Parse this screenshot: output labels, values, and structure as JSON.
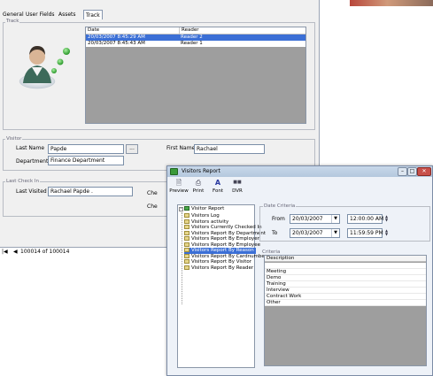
{
  "main": {
    "tabs": [
      "General",
      "User Fields",
      "Assets",
      "Track"
    ],
    "track": {
      "legend": "Track",
      "columns": [
        "Date",
        "Reader"
      ],
      "rows": [
        {
          "date": "20/03/2007 8:45:29 AM",
          "reader": "Reader 2"
        },
        {
          "date": "20/03/2007 8:45:43 AM",
          "reader": "Reader 1"
        }
      ]
    },
    "visitor": {
      "legend": "Visitor",
      "last_name_label": "Last Name",
      "last_name_value": "Papde",
      "dots": "...",
      "first_name_label": "First Name",
      "first_name_value": "Rachael",
      "department_label": "Department",
      "department_value": "Finance Department"
    },
    "check_in": {
      "legend": "Last Check In",
      "last_visited_label": "Last Visited",
      "last_visited_value": "Rachael Papde .",
      "che_label_1": "Che",
      "che_label_2": "Che"
    },
    "nav": {
      "record_text": "100014 of 100014"
    }
  },
  "report_window": {
    "title": "Visitors Report",
    "toolbar": [
      "Preview",
      "Print",
      "Font",
      "DVR"
    ],
    "tree": {
      "root": "Visitor Report",
      "items": [
        "Visitors Log",
        "Visitors activity",
        "Visitors Currently Checked In",
        "Visitors Report By Department",
        "Visitors Report By Employer",
        "Visitors Report By Employee",
        "Visitors Report By Reason",
        "Visitors Report By Cardnumber",
        "Visitors Report By Visitor",
        "Visitors Report By Reader"
      ],
      "selected_index": 6
    },
    "date_criteria": {
      "legend": "Date Criteria",
      "from_label": "From",
      "from_date": "20/03/2007",
      "from_time": "12:00:00 AM",
      "to_label": "To",
      "to_date": "20/03/2007",
      "to_time": "11:59:59 PM"
    },
    "criteria": {
      "legend": "Criteria",
      "column": "Description",
      "rows": [
        "",
        "Meeting",
        "Demo",
        "Training",
        "Interview",
        "Contract Work",
        "Other"
      ]
    }
  }
}
